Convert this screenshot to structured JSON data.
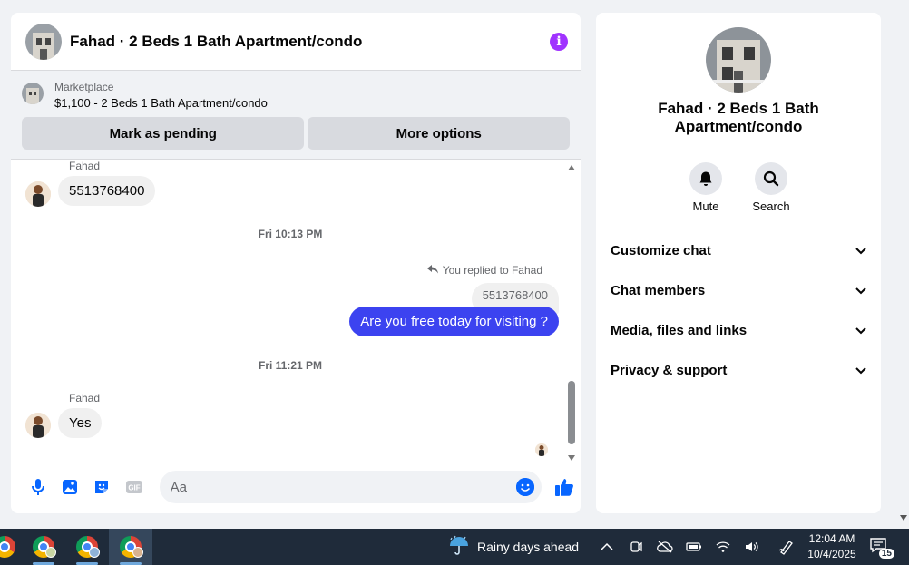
{
  "chat": {
    "title": "Fahad · 2 Beds 1 Bath Apartment/condo",
    "marketplace_label": "Marketplace",
    "listing": "$1,100 - 2 Beds 1 Bath Apartment/condo",
    "mark_pending_label": "Mark as pending",
    "more_options_label": "More options"
  },
  "messages": {
    "sender_1": "Fahad",
    "msg_1": "5513768400",
    "time_1": "Fri 10:13 PM",
    "reply_note": "You replied to Fahad",
    "reply_quote": "5513768400",
    "msg_out": "Are you free today for visiting ?",
    "time_2": "Fri 11:21 PM",
    "sender_2": "Fahad",
    "msg_2": "Yes"
  },
  "composer": {
    "placeholder": "Aa"
  },
  "info_panel": {
    "title": "Fahad · 2 Beds 1 Bath Apartment/condo",
    "mute_label": "Mute",
    "search_label": "Search",
    "sections": [
      "Customize chat",
      "Chat members",
      "Media, files and links",
      "Privacy & support"
    ]
  },
  "taskbar": {
    "weather": "Rainy days ahead",
    "time": "12:04 AM",
    "date": "10/4/2025",
    "notification_count": "15"
  },
  "colors": {
    "accent_blue": "#3c43f0",
    "info_purple": "#a033ff",
    "taskbar": "#1f2b3a"
  }
}
